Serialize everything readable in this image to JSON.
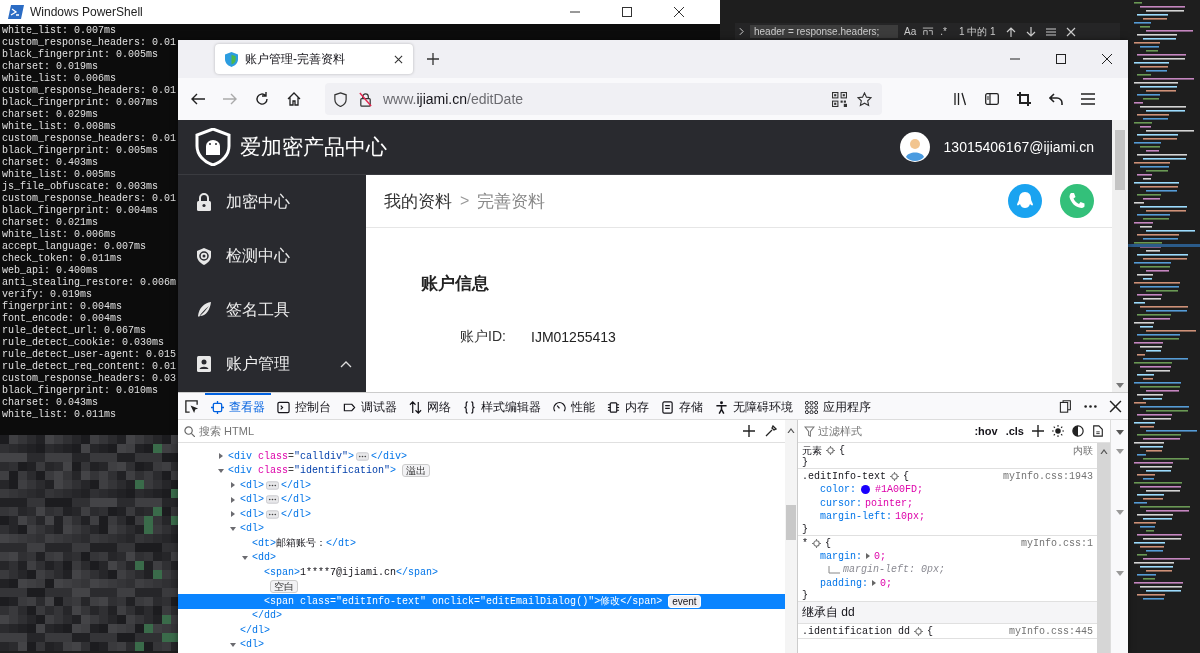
{
  "powershell": {
    "title": "Windows PowerShell",
    "lines": [
      "white_list: 0.007ms",
      "custom_response_headers: 0.01",
      "black_fingerprint: 0.005ms",
      "charset: 0.019ms",
      "white_list: 0.006ms",
      "custom_response_headers: 0.01",
      "black_fingerprint: 0.007ms",
      "charset: 0.029ms",
      "white_list: 0.008ms",
      "custom_response_headers: 0.01",
      "black_fingerprint: 0.005ms",
      "charset: 0.403ms",
      "white_list: 0.005ms",
      "js_file_obfuscate: 0.003ms",
      "custom_response_headers: 0.01",
      "black_fingerprint: 0.004ms",
      "charset: 0.021ms",
      "white_list: 0.006ms",
      "accept_language: 0.007ms",
      "check_token: 0.011ms",
      "web_api: 0.400ms",
      "anti_stealing_restore: 0.006m",
      "verify: 0.019ms",
      "fingerprint: 0.004ms",
      "font_encode: 0.004ms",
      "rule_detect_url: 0.067ms",
      "rule_detect_cookie: 0.030ms",
      "rule_detect_user-agent: 0.015",
      "rule_detect_req_content: 0.01",
      "custom_response_headers: 0.03",
      "black_fingerprint: 0.010ms",
      "charset: 0.043ms",
      "white_list: 0.011ms"
    ]
  },
  "editor": {
    "find": {
      "query": "header = response.headers;",
      "match_case": "Aa",
      "regex": ".*",
      "result": "1 中的 1"
    }
  },
  "browser": {
    "tabs": [
      {
        "title": "账户管理-完善资料",
        "selected": true
      }
    ],
    "url": {
      "prefix": "www.",
      "domain": "ijiami.cn",
      "path": "/editDate"
    }
  },
  "page": {
    "brand": "爱加密产品中心",
    "user_email": "13015406167@ijiami.cn",
    "sidebar": [
      {
        "label": "加密中心",
        "kind": "lock"
      },
      {
        "label": "检测中心",
        "kind": "target"
      },
      {
        "label": "签名工具",
        "kind": "feather"
      },
      {
        "label": "账户管理",
        "kind": "card",
        "expanded": true
      }
    ],
    "breadcrumb": [
      {
        "label": "我的资料",
        "current": false
      },
      {
        "label": "完善资料",
        "current": true
      }
    ],
    "breadcrumb_separator": ">",
    "section_title": "账户信息",
    "fields": [
      {
        "label": "账户ID:",
        "value": "IJM01255413"
      }
    ]
  },
  "devtools": {
    "tabs": [
      {
        "label": "查看器",
        "kind": "inspector",
        "selected": true
      },
      {
        "label": "控制台",
        "kind": "console",
        "selected": false
      },
      {
        "label": "调试器",
        "kind": "debugger",
        "selected": false
      },
      {
        "label": "网络",
        "kind": "network",
        "selected": false
      },
      {
        "label": "样式编辑器",
        "kind": "style",
        "selected": false
      },
      {
        "label": "性能",
        "kind": "performance",
        "selected": false
      },
      {
        "label": "内存",
        "kind": "memory",
        "selected": false
      },
      {
        "label": "存储",
        "kind": "storage",
        "selected": false
      },
      {
        "label": "无障碍环境",
        "kind": "accessibility",
        "selected": false
      },
      {
        "label": "应用程序",
        "kind": "application",
        "selected": false
      }
    ],
    "search_placeholder": "搜索 HTML",
    "tree": [
      {
        "open": "<div class=\"calldiv\">",
        "close": "</div>",
        "expanded": false,
        "selected": false
      },
      {
        "open": "<div class=\"identification\">",
        "badge": "溢出",
        "expanded": true,
        "selected": false,
        "children": [
          {
            "open": "<dl>",
            "close": "</dl>",
            "expanded": false,
            "selected": false
          },
          {
            "open": "<dl>",
            "close": "</dl>",
            "expanded": false,
            "selected": false
          },
          {
            "open": "<dl>",
            "close": "</dl>",
            "expanded": false,
            "selected": false
          },
          {
            "open": "<dl>",
            "close": "</dl>",
            "expanded": true,
            "selected": false,
            "children": [
              {
                "open": "<dt>",
                "text": "邮箱账号：",
                "close": "</dt>",
                "selected": false
              },
              {
                "open": "<dd>",
                "close": "</dd>",
                "expanded": true,
                "selected": false,
                "children": [
                  {
                    "open": "<span>",
                    "text": "1****7@ijiami.cn",
                    "close": "</span>",
                    "selected": false
                  },
                  {
                    "kind": "whitespace",
                    "badge": "空白",
                    "selected": false
                  },
                  {
                    "open": "<span class=\"editInfo-text\" onclick=\"editEmailDialog()\">",
                    "text": "修改",
                    "close": "</span>",
                    "badge": "event",
                    "selected": true
                  }
                ]
              }
            ]
          },
          {
            "open": "<dl>",
            "expanded": true,
            "selected": false
          }
        ]
      }
    ],
    "filter_placeholder": "过滤样式",
    "pseudo": ":hov",
    "classes": ".cls",
    "rules": [
      {
        "selector": "元素",
        "source": "内联",
        "open": "{",
        "close": "}"
      },
      {
        "selector": ".editInfo-text",
        "source": "myInfo.css:1943",
        "open": "{",
        "close": "}",
        "decls": [
          {
            "prop": "color:",
            "value": "#1A00FD;",
            "color": "#1a00fd"
          },
          {
            "prop": "cursor:",
            "value": "pointer;"
          },
          {
            "prop": "margin-left:",
            "value": "10px;"
          }
        ]
      },
      {
        "selector": "*",
        "source": "myInfo.css:1",
        "open": "{",
        "close": "}",
        "decls": [
          {
            "prop": "margin:",
            "value": "0;",
            "expanded": false,
            "longhands": [
              {
                "prop": "margin-left:",
                "value": "0px;",
                "overridden": true
              }
            ]
          },
          {
            "prop": "padding:",
            "value": "0;",
            "expanded": false
          }
        ]
      }
    ],
    "inherited_label": "继承自 dd",
    "inherited_rules": [
      {
        "selector": ".identification dd",
        "source": "myInfo.css:445",
        "open": "{"
      }
    ]
  }
}
